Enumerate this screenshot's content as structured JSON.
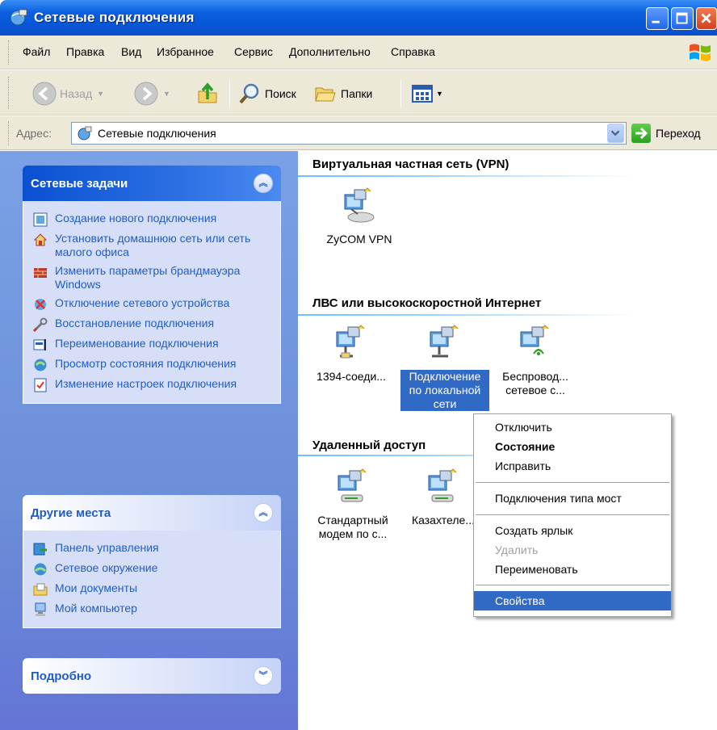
{
  "window": {
    "title": "Сетевые подключения"
  },
  "menubar": {
    "items": [
      "Файл",
      "Правка",
      "Вид",
      "Избранное",
      "Сервис",
      "Дополнительно",
      "Справка"
    ]
  },
  "toolbar": {
    "back_label": "Назад",
    "search_label": "Поиск",
    "folders_label": "Папки"
  },
  "addressbar": {
    "label": "Адрес:",
    "value": "Сетевые подключения",
    "go_label": "Переход"
  },
  "sidebar": {
    "network_tasks": {
      "title": "Сетевые задачи",
      "items": [
        {
          "label": "Создание нового подключения",
          "icon": "new-connection-icon"
        },
        {
          "label": "Установить домашнюю сеть или сеть малого офиса",
          "icon": "home-network-icon"
        },
        {
          "label": "Изменить параметры брандмауэра Windows",
          "icon": "firewall-icon"
        },
        {
          "label": "Отключение сетевого устройства",
          "icon": "disable-device-icon"
        },
        {
          "label": "Восстановление подключения",
          "icon": "repair-icon"
        },
        {
          "label": "Переименование подключения",
          "icon": "rename-icon"
        },
        {
          "label": "Просмотр состояния подключения",
          "icon": "status-icon"
        },
        {
          "label": "Изменение настроек подключения",
          "icon": "settings-icon"
        }
      ]
    },
    "other_places": {
      "title": "Другие места",
      "items": [
        {
          "label": "Панель управления",
          "icon": "control-panel-icon"
        },
        {
          "label": "Сетевое окружение",
          "icon": "network-places-icon"
        },
        {
          "label": "Мои документы",
          "icon": "my-documents-icon"
        },
        {
          "label": "Мой компьютер",
          "icon": "my-computer-icon"
        }
      ]
    },
    "details": {
      "title": "Подробно"
    }
  },
  "content": {
    "groups": [
      {
        "title": "Виртуальная частная сеть (VPN)",
        "items": [
          {
            "label": "ZyCOM VPN",
            "icon": "vpn-connection-icon"
          }
        ]
      },
      {
        "title": "ЛВС или высокоскоростной Интернет",
        "items": [
          {
            "label": "1394-соеди...",
            "icon": "lan-connection-icon"
          },
          {
            "label": "Подключение по локальной сети",
            "icon": "lan-connection-icon",
            "selected": true
          },
          {
            "label": "Беспровод... сетевое с...",
            "icon": "wireless-connection-icon"
          }
        ]
      },
      {
        "title": "Удаленный доступ",
        "items": [
          {
            "label": "Стандартный модем по с...",
            "icon": "dialup-connection-icon"
          },
          {
            "label": "Казахтеле...",
            "icon": "dialup-connection-icon"
          }
        ]
      }
    ]
  },
  "context_menu": {
    "items": [
      {
        "label": "Отключить",
        "state": "normal"
      },
      {
        "label": "Состояние",
        "state": "bold"
      },
      {
        "label": "Исправить",
        "state": "normal"
      },
      {
        "label": "Подключения типа мост",
        "state": "normal"
      },
      {
        "label": "Создать ярлык",
        "state": "normal"
      },
      {
        "label": "Удалить",
        "state": "disabled"
      },
      {
        "label": "Переименовать",
        "state": "normal"
      },
      {
        "label": "Свойства",
        "state": "selected"
      }
    ]
  },
  "colors": {
    "titlebar": "#0657d8",
    "sidebar": "#6b8fd8",
    "task_text": "#215dc6",
    "selection": "#316ac5"
  }
}
